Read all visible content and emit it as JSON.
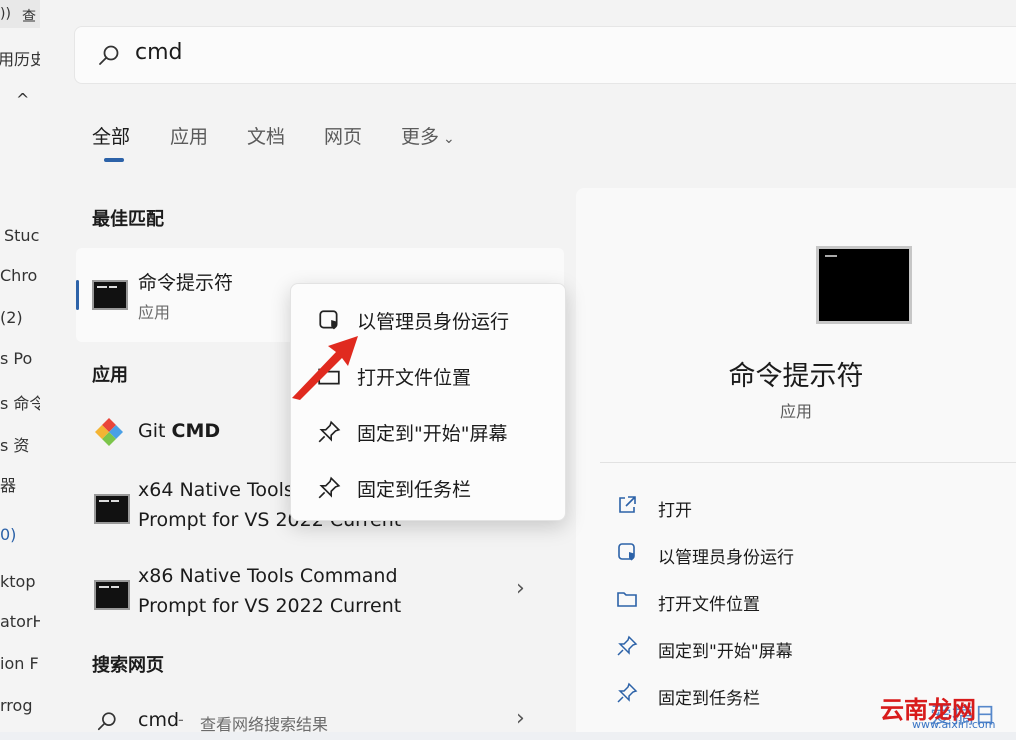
{
  "background_window": {
    "fragments": [
      "))",
      "查",
      "用历史",
      "^",
      "Stuc",
      "Chro",
      "(2)",
      "s Po",
      "s 命令",
      "s 资",
      "器",
      "0)",
      "ktop",
      "atorH",
      "ion F",
      "rrog"
    ]
  },
  "search": {
    "query": "cmd"
  },
  "tabs": [
    {
      "label": "全部",
      "active": true
    },
    {
      "label": "应用",
      "active": false
    },
    {
      "label": "文档",
      "active": false
    },
    {
      "label": "网页",
      "active": false
    },
    {
      "label": "更多",
      "active": false
    }
  ],
  "sections": {
    "best_match": "最佳匹配",
    "apps": "应用",
    "web": "搜索网页"
  },
  "best_match": {
    "name": "命令提示符",
    "kind": "应用"
  },
  "apps": [
    {
      "name_prefix": "Git ",
      "name_bold": "CMD",
      "icon": "git-icon"
    },
    {
      "line1": "x64 Native Tools Command",
      "line2": "Prompt for VS 2022 Current",
      "icon": "cmd-icon"
    },
    {
      "line1": "x86 Native Tools Command",
      "line2": "Prompt for VS 2022 Current",
      "icon": "cmd-icon"
    }
  ],
  "web_result": {
    "query": "cmd",
    "separator": " - ",
    "hint": "查看网络搜索结果"
  },
  "context_menu": [
    {
      "label": "以管理员身份运行",
      "icon": "shield-icon"
    },
    {
      "label": "打开文件位置",
      "icon": "folder-icon"
    },
    {
      "label": "固定到\"开始\"屏幕",
      "icon": "pin-icon"
    },
    {
      "label": "固定到任务栏",
      "icon": "pin-icon"
    }
  ],
  "preview": {
    "title": "命令提示符",
    "subtitle": "应用",
    "actions": [
      {
        "label": "打开",
        "icon": "open-icon"
      },
      {
        "label": "以管理员身份运行",
        "icon": "shield-icon"
      },
      {
        "label": "打开文件位置",
        "icon": "folder-icon"
      },
      {
        "label": "固定到\"开始\"屏幕",
        "icon": "pin-icon"
      },
      {
        "label": "固定到任务栏",
        "icon": "pin-icon"
      }
    ]
  },
  "watermark": {
    "main": "云南龙网",
    "sub": "爱搞日",
    "url": "www.aixiri.com"
  },
  "colors": {
    "accent": "#2c62a8",
    "arrow": "#e02a1f",
    "watermark": "#d81b1b"
  }
}
